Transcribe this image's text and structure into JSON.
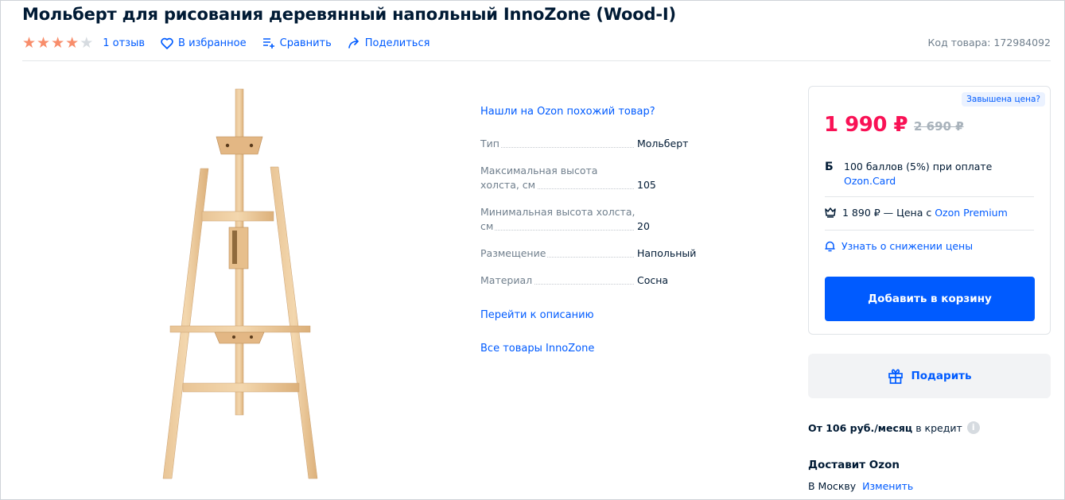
{
  "product": {
    "title": "Мольберт для рисования деревянный напольный InnoZone (Wood-I)",
    "rating": 4,
    "rating_max": 5,
    "reviews_label": "1 отзыв",
    "sku_label": "Код товара: 172984092"
  },
  "actions": {
    "favorite": "В избранное",
    "compare": "Сравнить",
    "share": "Поделиться"
  },
  "specs": {
    "similar_link": "Нашли на Ozon похожий товар?",
    "rows": [
      {
        "name": "Тип",
        "value": "Мольберт"
      },
      {
        "name": "Максимальная высота холста, см",
        "value": "105"
      },
      {
        "name": "Минимальная высота холста, см",
        "value": "20"
      },
      {
        "name": "Размещение",
        "value": "Напольный"
      },
      {
        "name": "Материал",
        "value": "Сосна"
      }
    ],
    "goto_description": "Перейти к описанию",
    "all_brand": "Все товары InnoZone"
  },
  "price_card": {
    "overpriced_badge": "Завышена цена?",
    "price": "1 990 ₽",
    "old_price": "2 690 ₽",
    "bonus_icon": "Б",
    "bonus_text": "100 баллов (5%) при оплате",
    "bonus_link": "Ozon.Card",
    "premium_text": "1 890 ₽ — Цена с",
    "premium_link": "Ozon Premium",
    "notify": "Узнать о снижении цены",
    "add_to_cart": "Добавить в корзину"
  },
  "gift": {
    "label": "Подарить"
  },
  "credit": {
    "amount": "От 106 руб./месяц",
    "suffix": "в кредит",
    "info_icon": "i"
  },
  "delivery": {
    "title": "Доставит Ozon",
    "city": "В Москву",
    "change": "Изменить"
  },
  "colors": {
    "accent": "#005bff",
    "price": "#f91155",
    "star": "#f88d6b",
    "star_empty": "#d6dbe0"
  }
}
